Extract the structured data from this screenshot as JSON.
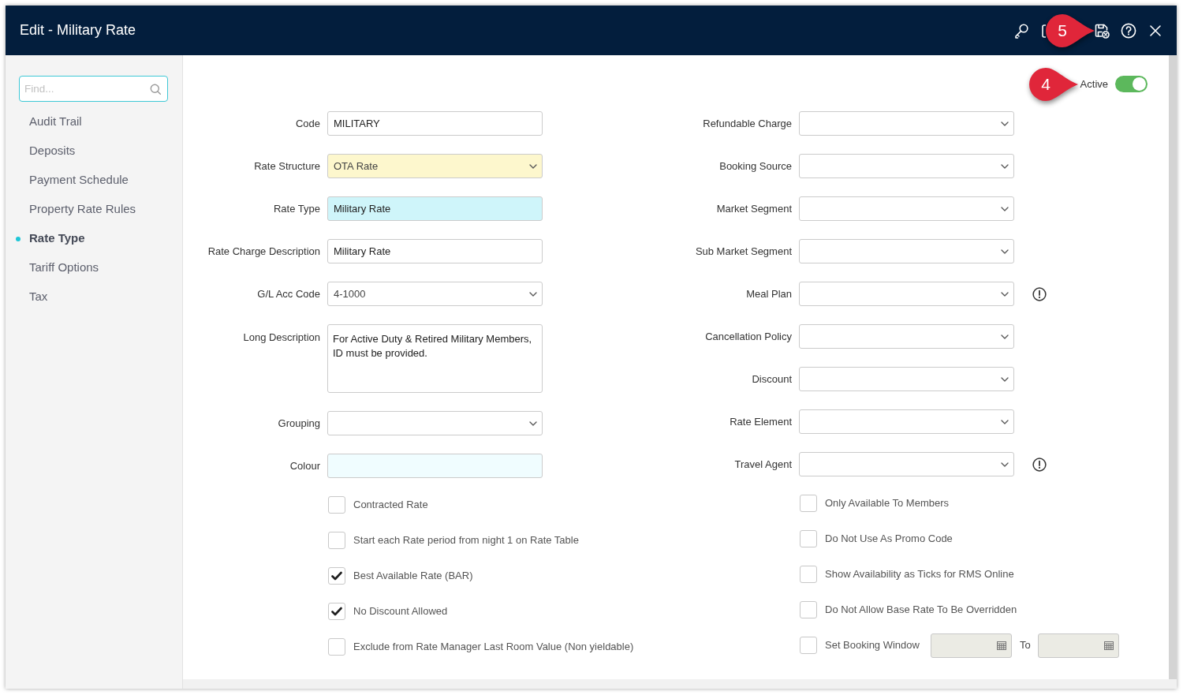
{
  "window": {
    "title": "Edit - Military Rate",
    "callout": "5"
  },
  "sidebar": {
    "search": {
      "placeholder": "Find..."
    },
    "items": [
      {
        "label": "Audit Trail",
        "selected": false
      },
      {
        "label": "Deposits",
        "selected": false
      },
      {
        "label": "Payment Schedule",
        "selected": false
      },
      {
        "label": "Property Rate Rules",
        "selected": false
      },
      {
        "label": "Rate Type",
        "selected": true
      },
      {
        "label": "Tariff Options",
        "selected": false
      },
      {
        "label": "Tax",
        "selected": false
      }
    ]
  },
  "active_toggle": {
    "label": "Active",
    "on": true,
    "callout": "4"
  },
  "left_fields": [
    {
      "label": "Code",
      "kind": "text",
      "value": "MILITARY"
    },
    {
      "label": "Rate Structure",
      "kind": "select",
      "value": "OTA Rate",
      "color": "#fdf7cd"
    },
    {
      "label": "Rate Type",
      "kind": "text",
      "value": "Military Rate",
      "color": "#cff5fa"
    },
    {
      "label": "Rate Charge Description",
      "kind": "text",
      "value": "Military Rate"
    },
    {
      "label": "G/L Acc Code",
      "kind": "select",
      "value": "4-1000"
    },
    {
      "label": "Long Description",
      "kind": "textarea",
      "value": "For Active Duty & Retired Military Members, ID must be provided."
    },
    {
      "label": "Grouping",
      "kind": "select"
    },
    {
      "label": "Colour",
      "kind": "text",
      "color": "#f0fdff"
    }
  ],
  "right_fields": [
    {
      "label": "Refundable Charge",
      "kind": "select",
      "info": false
    },
    {
      "label": "Booking Source",
      "kind": "select",
      "info": false
    },
    {
      "label": "Market Segment",
      "kind": "select",
      "info": false
    },
    {
      "label": "Sub Market Segment",
      "kind": "select",
      "info": false
    },
    {
      "label": "Meal Plan",
      "kind": "select",
      "info": true
    },
    {
      "label": "Cancellation Policy",
      "kind": "select",
      "info": false
    },
    {
      "label": "Discount",
      "kind": "select",
      "info": false
    },
    {
      "label": "Rate Element",
      "kind": "select",
      "info": false
    },
    {
      "label": "Travel Agent",
      "kind": "select",
      "info": true
    }
  ],
  "left_options": [
    {
      "label": "Contracted Rate",
      "checked": false
    },
    {
      "label": "Start each Rate period from night 1 on Rate Table",
      "checked": false
    },
    {
      "label": "Best Available Rate (BAR)",
      "checked": true
    },
    {
      "label": "No Discount Allowed",
      "checked": true
    },
    {
      "label": "Exclude from Rate Manager Last Room Value (Non yieldable)",
      "checked": false
    }
  ],
  "right_options": [
    {
      "kind": "checkbox",
      "label": "Only Available To Members",
      "checked": false
    },
    {
      "kind": "checkbox",
      "label": "Do Not Use As Promo Code",
      "checked": false
    },
    {
      "kind": "checkbox",
      "label": "Show Availability as Ticks for RMS Online",
      "checked": false
    },
    {
      "kind": "checkbox",
      "label": "Do Not Allow Base Rate To Be Overridden",
      "checked": false
    },
    {
      "kind": "date_range",
      "label": "Set Booking Window",
      "checked": false,
      "to_label": "To",
      "disabled": true
    }
  ]
}
